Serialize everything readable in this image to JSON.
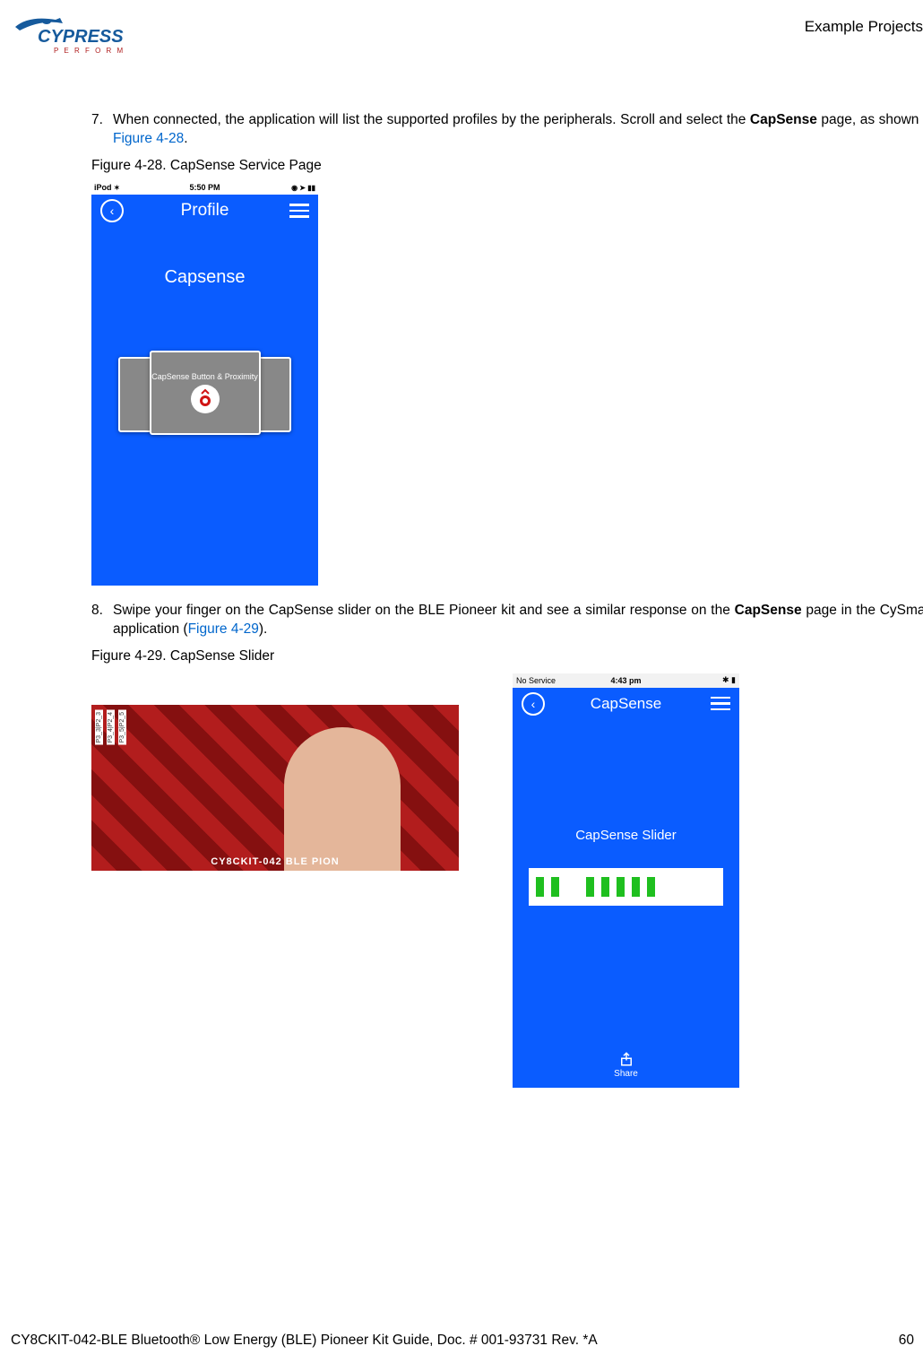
{
  "header": {
    "logo_main": "CYPRESS",
    "logo_sub": "P E R F O R M",
    "section": "Example Projects"
  },
  "steps": {
    "s7_num": "7.",
    "s7_a": "When connected, the application will list the supported profiles by the peripherals. Scroll and select the ",
    "s7_bold": "CapSense",
    "s7_b": " page, as shown in ",
    "s7_link": "Figure 4-28",
    "s7_c": ".",
    "s8_num": "8.",
    "s8_a": "Swipe your finger on the CapSense slider on the BLE Pioneer kit and see a similar response on the ",
    "s8_bold": "CapSense",
    "s8_b": " page in the CySmart application (",
    "s8_link": "Figure 4-29",
    "s8_c": ")."
  },
  "fig1": {
    "caption": "Figure 4-28.  CapSense Service Page",
    "status_left": "iPod",
    "status_time": "5:50 PM",
    "nav_title": "Profile",
    "body_title": "Capsense",
    "card_label": "CapSense Button & Proximity"
  },
  "fig2": {
    "caption": "Figure 4-29.  CapSense Slider",
    "board_text": "CY8CKIT-042 BLE PION",
    "gpio": [
      "P3_3|P2_3",
      "P3_4|P2_4",
      "P3_5|P2_5"
    ],
    "status_left": "No Service",
    "status_time": "4:43 pm",
    "nav_title": "CapSense",
    "body_title": "CapSense Slider",
    "share": "Share"
  },
  "footer": {
    "left": "CY8CKIT-042-BLE Bluetooth® Low Energy (BLE) Pioneer Kit Guide, Doc. # 001-93731 Rev. *A",
    "page": "60"
  }
}
